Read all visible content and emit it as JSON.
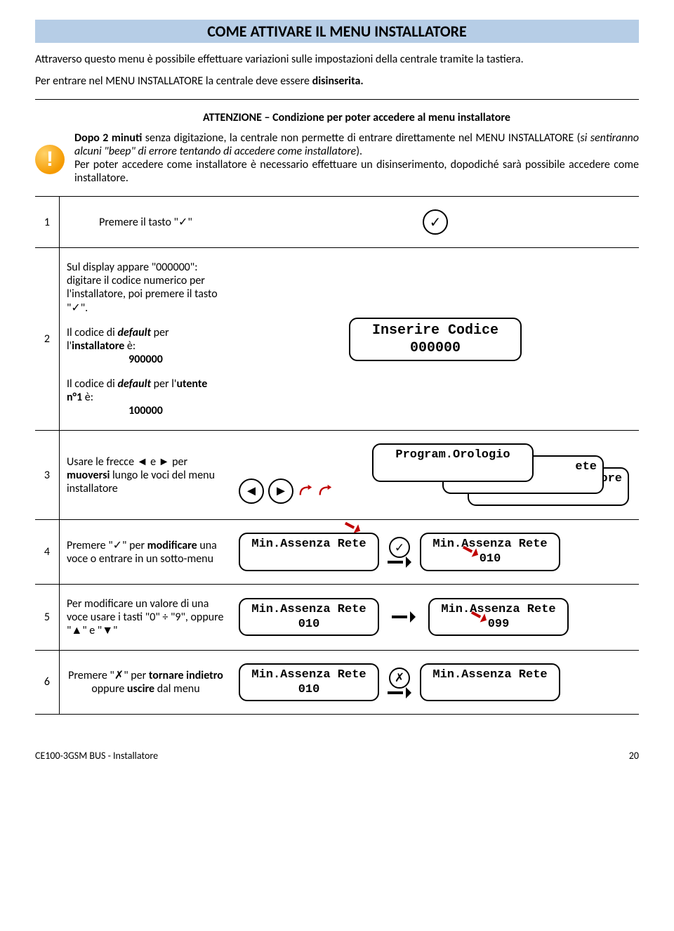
{
  "title": "COME ATTIVARE IL MENU INSTALLATORE",
  "intro1": "Attraverso questo menu è possibile effettuare variazioni sulle impostazioni della centrale tramite la tastiera.",
  "intro2_pre": "Per entrare nel MENU INSTALLATORE la centrale deve essere ",
  "intro2_bold": "disinserita.",
  "warning": {
    "title": "ATTENZIONE – Condizione per poter accedere al menu installatore",
    "p1_a": "Dopo 2 minuti",
    "p1_b": " senza digitazione, la centrale non permette di entrare direttamente nel MENU INSTALLATORE (",
    "p1_c": "si sentiranno alcuni \"beep\" di errore tentando di accedere come installatore",
    "p1_d": ").",
    "p2": "Per poter accedere come installatore è necessario effettuare un disinserimento, dopodiché sarà possibile accedere come installatore."
  },
  "steps": {
    "s1": {
      "num": "1",
      "text": "Premere il tasto \"✓\""
    },
    "s2": {
      "num": "2",
      "block1": "Sul display appare \"000000\": digitare il codice numerico per l'installatore, poi premere il tasto \"✓\".",
      "block2_pre": "Il codice di ",
      "block2_bold_def": "default",
      "block2_mid": " per l'",
      "block2_bold_role": "installatore",
      "block2_post": " è:",
      "code_installer": "900000",
      "block3_pre": "Il codice di ",
      "block3_bold_def": "default",
      "block3_mid": " per l'",
      "block3_bold_role": "utente n°1",
      "block3_post": " è:",
      "code_user": "100000",
      "lcd_line1": "Inserire Codice",
      "lcd_line2": "000000"
    },
    "s3": {
      "num": "3",
      "text_pre": "Usare le frecce ◄ e ► per ",
      "text_bold": "muoversi",
      "text_post": " lungo le voci del menu installatore",
      "lcd_top": "Program.Orologio",
      "lcd_mid_vis": "ete",
      "lcd_bot_vis": "ore"
    },
    "s4": {
      "num": "4",
      "text_pre": "Premere \"✓\" per ",
      "text_bold": "modificare",
      "text_post": " una voce o entrare in un sotto-menu",
      "lcd1": "Min.Assenza Rete",
      "lcd2_l1": "Min.Assenza Rete",
      "lcd2_l2": "010"
    },
    "s5": {
      "num": "5",
      "text": "Per modificare un valore di una voce usare i tasti \"0\" ÷ \"9\", oppure \"▲\" e \"▼\"",
      "lcd1_l1": "Min.Assenza Rete",
      "lcd1_l2": "010",
      "lcd2_l1": "Min.Assenza Rete",
      "lcd2_l2": "099"
    },
    "s6": {
      "num": "6",
      "text_pre": "Premere \"✗\" per ",
      "text_bold1": "tornare indietro",
      "text_mid": " oppure ",
      "text_bold2": "uscire",
      "text_post": " dal menu",
      "lcd1_l1": "Min.Assenza Rete",
      "lcd1_l2": "010",
      "lcd2_l1": "Min.Assenza Rete"
    }
  },
  "footer": {
    "left": "CE100-3GSM BUS - Installatore",
    "right": "20"
  },
  "glyphs": {
    "check": "✓",
    "cross": "✗",
    "left": "◄",
    "right": "►"
  }
}
